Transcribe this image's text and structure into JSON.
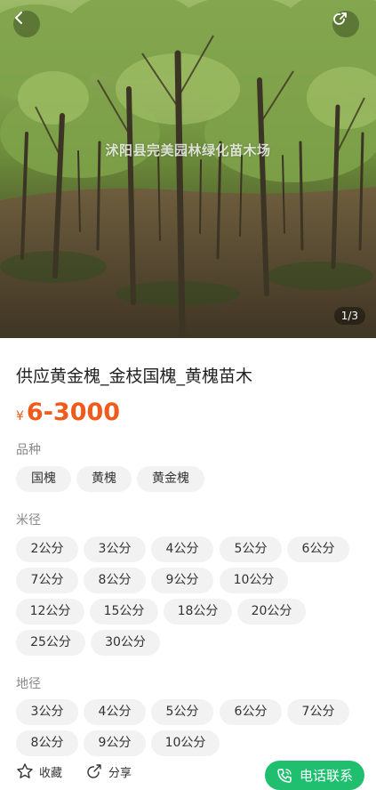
{
  "hero": {
    "watermark": "沭阳县完美园林绿化苗木场",
    "counter": "1/3",
    "icons": {
      "back": "chevron-left-icon",
      "share": "share-icon"
    }
  },
  "product": {
    "title": "供应黄金槐_金枝国槐_黄槐苗木",
    "price": {
      "currency": "¥",
      "value": "6-3000"
    },
    "colors": {
      "price": "#f05a1a",
      "accent": "#1fbf6f",
      "chip_bg": "#f2f2f2"
    }
  },
  "sections": [
    {
      "label": "品种",
      "options": [
        "国槐",
        "黄槐",
        "黄金槐"
      ]
    },
    {
      "label": "米径",
      "options": [
        "2公分",
        "3公分",
        "4公分",
        "5公分",
        "6公分",
        "7公分",
        "8公分",
        "9公分",
        "10公分",
        "12公分",
        "15公分",
        "18公分",
        "20公分",
        "25公分",
        "30公分"
      ]
    },
    {
      "label": "地径",
      "options": [
        "3公分",
        "4公分",
        "5公分",
        "6公分",
        "7公分",
        "8公分",
        "9公分",
        "10公分"
      ]
    }
  ],
  "bottom_bar": {
    "favorite": {
      "label": "收藏",
      "icon": "star-icon"
    },
    "share": {
      "label": "分享",
      "icon": "share-icon"
    },
    "call": {
      "label": "电话联系",
      "icon": "phone-icon"
    }
  }
}
